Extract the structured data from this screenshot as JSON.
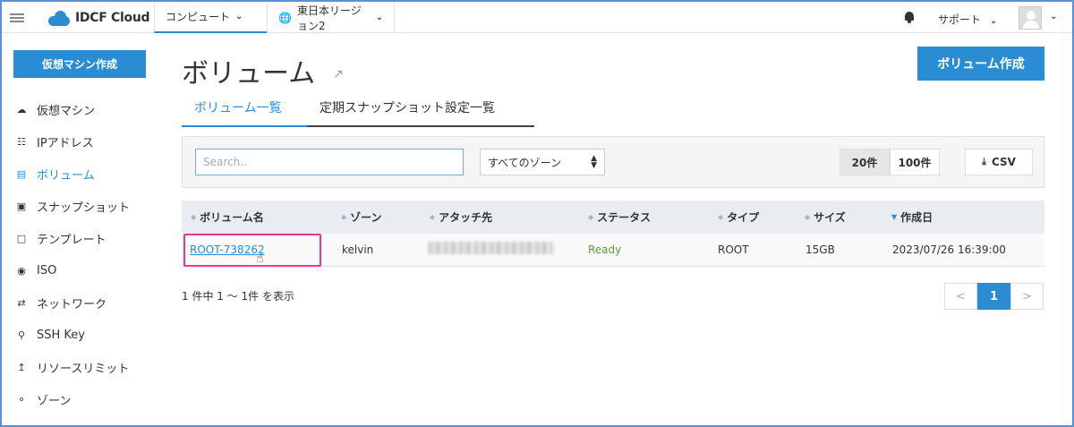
{
  "topbar": {
    "logo_text": "IDCF Cloud",
    "nav": [
      {
        "label": "コンピュート",
        "active": true
      },
      {
        "label": "東日本リージョン2",
        "active": false
      }
    ],
    "support_label": "サポート"
  },
  "sidebar": {
    "create_button": "仮想マシン作成",
    "items": [
      {
        "label": "仮想マシン",
        "icon": "cloud-icon"
      },
      {
        "label": "IPアドレス",
        "icon": "network-tree-icon"
      },
      {
        "label": "ボリューム",
        "icon": "volume-icon",
        "active": true
      },
      {
        "label": "スナップショット",
        "icon": "camera-icon"
      },
      {
        "label": "テンプレート",
        "icon": "document-icon"
      },
      {
        "label": "ISO",
        "icon": "disc-icon"
      },
      {
        "label": "ネットワーク",
        "icon": "shuffle-icon"
      },
      {
        "label": "SSH Key",
        "icon": "key-icon"
      },
      {
        "label": "リソースリミット",
        "icon": "arrow-up-icon"
      },
      {
        "label": "ゾーン",
        "icon": "share-icon"
      }
    ]
  },
  "main": {
    "title": "ボリューム",
    "create_button": "ボリューム作成",
    "tabs": [
      {
        "label": "ボリューム一覧",
        "active": true
      },
      {
        "label": "定期スナップショット設定一覧",
        "active": false
      }
    ],
    "search": {
      "placeholder": "Search..",
      "value": ""
    },
    "zone_select": {
      "selected": "すべてのゾーン"
    },
    "page_sizes": [
      {
        "label": "20件",
        "active": true
      },
      {
        "label": "100件",
        "active": false
      }
    ],
    "csv_label": "CSV",
    "table": {
      "columns": [
        "ボリューム名",
        "ゾーン",
        "アタッチ先",
        "ステータス",
        "タイプ",
        "サイズ",
        "作成日"
      ],
      "rows": [
        {
          "name": "ROOT-738262",
          "zone": "kelvin",
          "attached": "",
          "status": "Ready",
          "type": "ROOT",
          "size": "15GB",
          "created": "2023/07/26 16:39:00"
        }
      ]
    },
    "summary": "1 件中 1 ～ 1件 を表示",
    "pager": {
      "prev": "<",
      "current": "1",
      "next": ">"
    }
  },
  "colors": {
    "accent": "#2a8dd4",
    "status_ready": "#5a9b3a",
    "highlight": "#e8388c"
  }
}
